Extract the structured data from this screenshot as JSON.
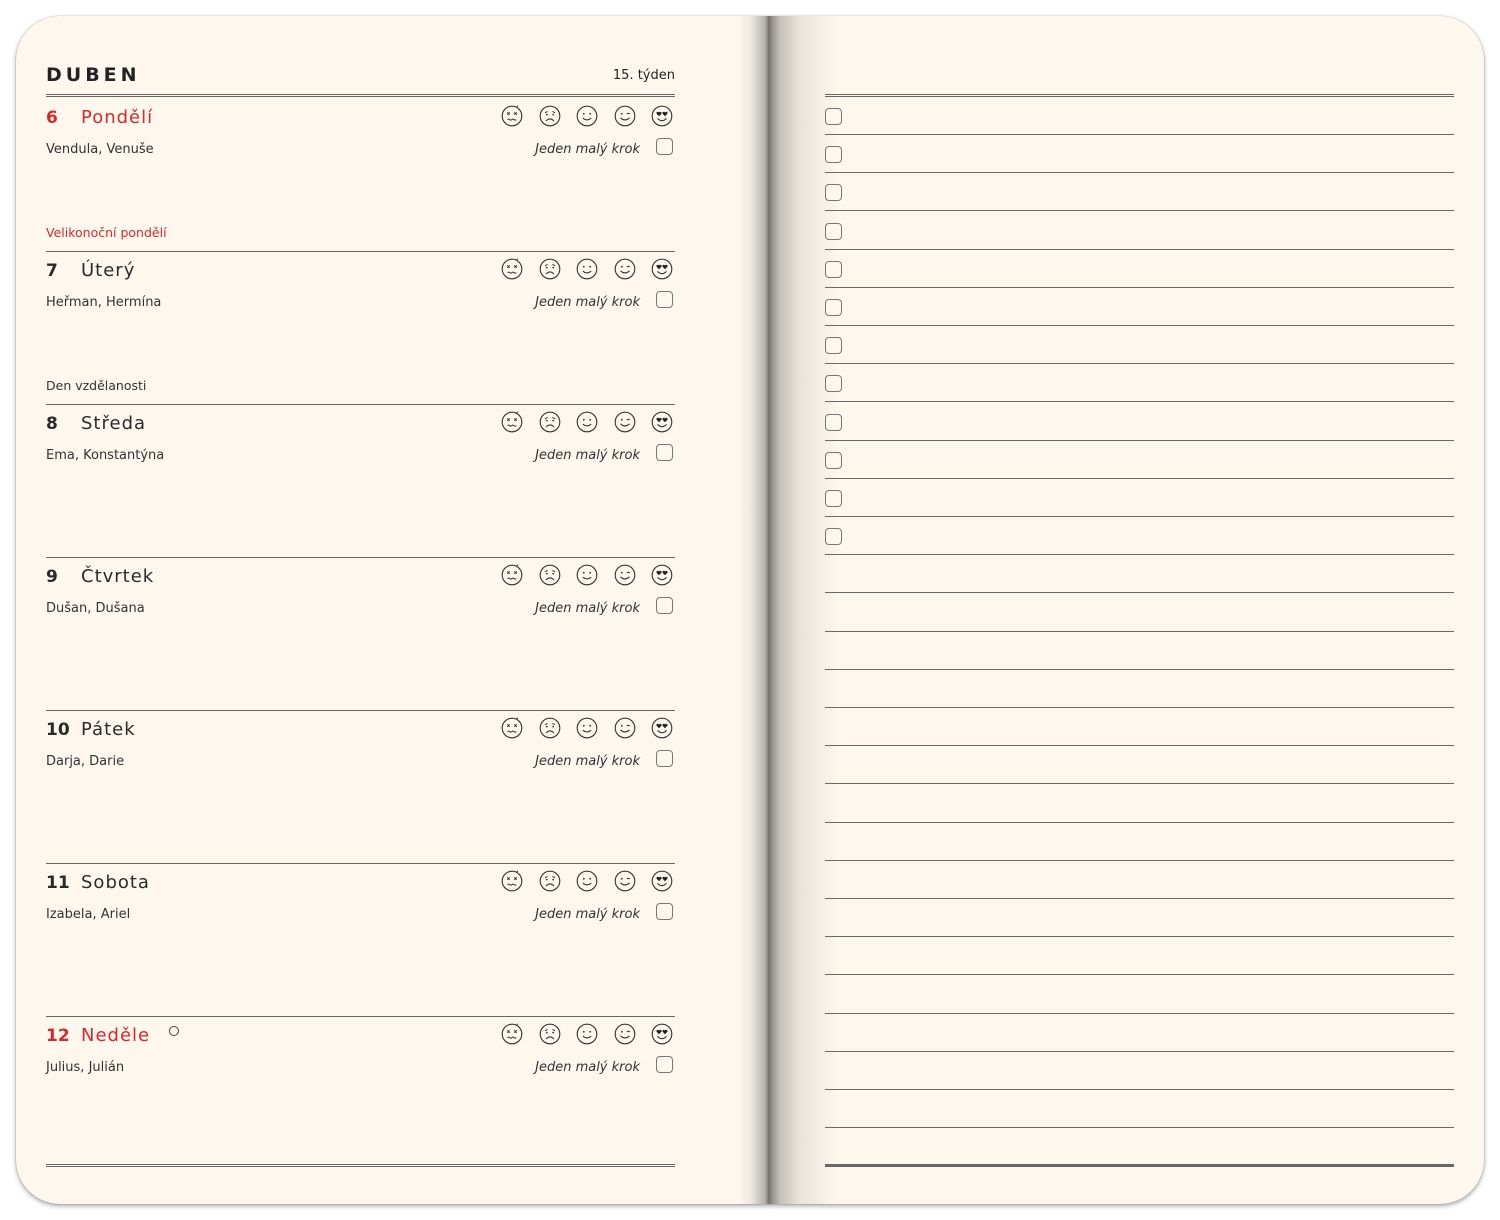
{
  "header": {
    "month": "DUBEN",
    "week": "15. týden"
  },
  "mood_icons": [
    "dizzy-face-icon",
    "sad-face-icon",
    "neutral-smile-face-icon",
    "winking-face-icon",
    "heart-eyes-face-icon"
  ],
  "colors": {
    "paper": "#fdf7ee",
    "accent_red": "#d8282a",
    "ink": "#2a2a2a"
  },
  "days": [
    {
      "number": "6",
      "name": "Pondělí",
      "names_day": "Vendula, Venuše",
      "step_label": "Jeden malý krok",
      "step_done": false,
      "holiday": "Velikonoční pondělí",
      "holiday_red": true,
      "red": true,
      "moon_phase": false
    },
    {
      "number": "7",
      "name": "Úterý",
      "names_day": "Heřman, Hermína",
      "step_label": "Jeden malý krok",
      "step_done": false,
      "holiday": "Den vzdělanosti",
      "holiday_red": false,
      "red": false,
      "moon_phase": false
    },
    {
      "number": "8",
      "name": "Středa",
      "names_day": "Ema, Konstantýna",
      "step_label": "Jeden malý krok",
      "step_done": false,
      "holiday": "",
      "holiday_red": false,
      "red": false,
      "moon_phase": false
    },
    {
      "number": "9",
      "name": "Čtvrtek",
      "names_day": "Dušan, Dušana",
      "step_label": "Jeden malý krok",
      "step_done": false,
      "holiday": "",
      "holiday_red": false,
      "red": false,
      "moon_phase": false
    },
    {
      "number": "10",
      "name": "Pátek",
      "names_day": "Darja, Darie",
      "step_label": "Jeden malý krok",
      "step_done": false,
      "holiday": "",
      "holiday_red": false,
      "red": false,
      "moon_phase": false
    },
    {
      "number": "11",
      "name": "Sobota",
      "names_day": "Izabela, Ariel",
      "step_label": "Jeden malý krok",
      "step_done": false,
      "holiday": "",
      "holiday_red": false,
      "red": false,
      "moon_phase": false
    },
    {
      "number": "12",
      "name": "Neděle",
      "names_day": "Julius, Julián",
      "step_label": "Jeden malý krok",
      "step_done": false,
      "holiday": "",
      "holiday_red": false,
      "red": true,
      "moon_phase": true
    }
  ],
  "notes_page": {
    "checklist_items": 12,
    "ruled_lines": 28
  }
}
